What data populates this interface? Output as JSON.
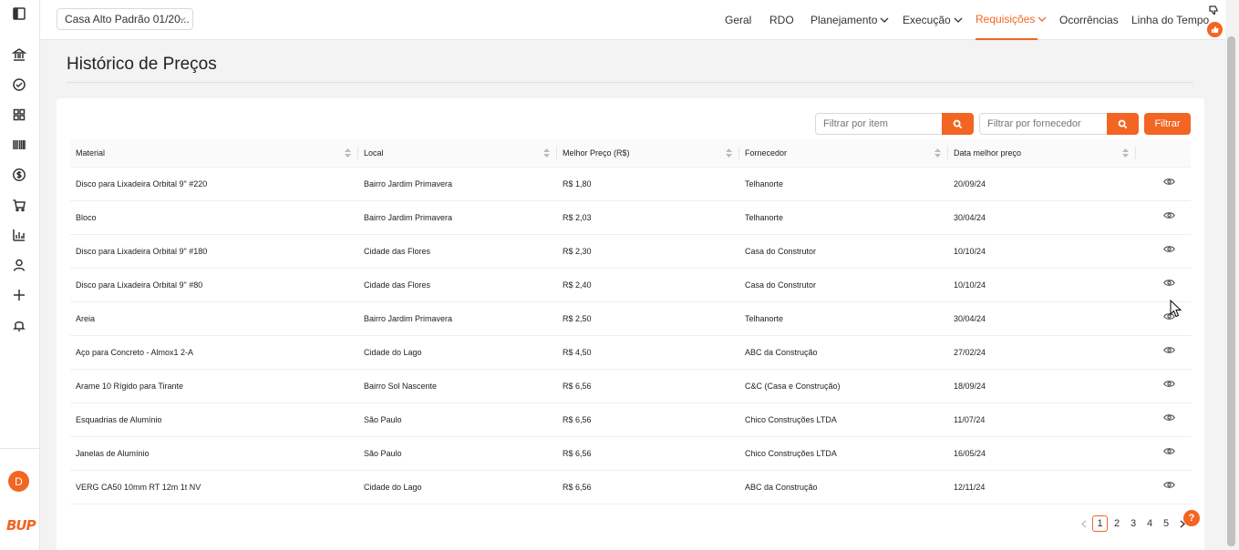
{
  "project": {
    "name": "Casa Alto Padrão 01/20..."
  },
  "nav": [
    {
      "label": "Geral"
    },
    {
      "label": "RDO"
    },
    {
      "label": "Planejamento"
    },
    {
      "label": "Execução"
    },
    {
      "label": "Requisições"
    },
    {
      "label": "Ocorrências"
    },
    {
      "label": "Linha do Tempo"
    }
  ],
  "active_nav": "Requisições",
  "accent_color": "#f26522",
  "sidebar": {
    "icons": [
      "panel-toggle-icon",
      "bank-icon",
      "check-circle-icon",
      "grid-icon",
      "barcode-icon",
      "dollar-icon",
      "cart-icon",
      "bar-chart-icon",
      "user-icon",
      "plus-icon",
      "bell-icon"
    ],
    "avatar_initial": "D",
    "logo_text": "BUP"
  },
  "page": {
    "title": "Histórico de Preços"
  },
  "filters": {
    "item_placeholder": "Filtrar por item",
    "supplier_placeholder": "Filtrar por fornecedor",
    "filter_label": "Filtrar"
  },
  "table": {
    "headers": [
      "Material",
      "Local",
      "Melhor Preço (R$)",
      "Fornecedor",
      "Data melhor preço"
    ],
    "rows": [
      {
        "material": "Disco para Lixadeira Orbital 9\" #220",
        "local": "Bairro Jardim Primavera",
        "preco": "R$ 1,80",
        "fornecedor": "Telhanorte",
        "data": "20/09/24"
      },
      {
        "material": "Bloco",
        "local": "Bairro Jardim Primavera",
        "preco": "R$ 2,03",
        "fornecedor": "Telhanorte",
        "data": "30/04/24"
      },
      {
        "material": "Disco para Lixadeira Orbital 9\" #180",
        "local": "Cidade das Flores",
        "preco": "R$ 2,30",
        "fornecedor": "Casa do Construtor",
        "data": "10/10/24"
      },
      {
        "material": "Disco para Lixadeira Orbital 9\" #80",
        "local": "Cidade das Flores",
        "preco": "R$ 2,40",
        "fornecedor": "Casa do Construtor",
        "data": "10/10/24"
      },
      {
        "material": "Areia",
        "local": "Bairro Jardim Primavera",
        "preco": "R$ 2,50",
        "fornecedor": "Telhanorte",
        "data": "30/04/24"
      },
      {
        "material": "Aço para Concreto - Almox1 2-A",
        "local": "Cidade do Lago",
        "preco": "R$ 4,50",
        "fornecedor": "ABC da Construção",
        "data": "27/02/24"
      },
      {
        "material": "Arame 10 Rígido para Tirante",
        "local": "Bairro Sol Nascente",
        "preco": "R$ 6,56",
        "fornecedor": "C&C (Casa e Construção)",
        "data": "18/09/24"
      },
      {
        "material": "Esquadrias de Alumínio",
        "local": "São Paulo",
        "preco": "R$ 6,56",
        "fornecedor": "Chico Construções LTDA",
        "data": "11/07/24"
      },
      {
        "material": "Janelas de Alumínio",
        "local": "São Paulo",
        "preco": "R$ 6,56",
        "fornecedor": "Chico Construções LTDA",
        "data": "16/05/24"
      },
      {
        "material": "VERG CA50 10mm RT 12m 1t NV",
        "local": "Cidade do Lago",
        "preco": "R$ 6,56",
        "fornecedor": "ABC da Construção",
        "data": "12/11/24"
      }
    ]
  },
  "pagination": {
    "pages": [
      "1",
      "2",
      "3",
      "4",
      "5"
    ],
    "current": "1"
  },
  "help": {
    "label": "?"
  }
}
